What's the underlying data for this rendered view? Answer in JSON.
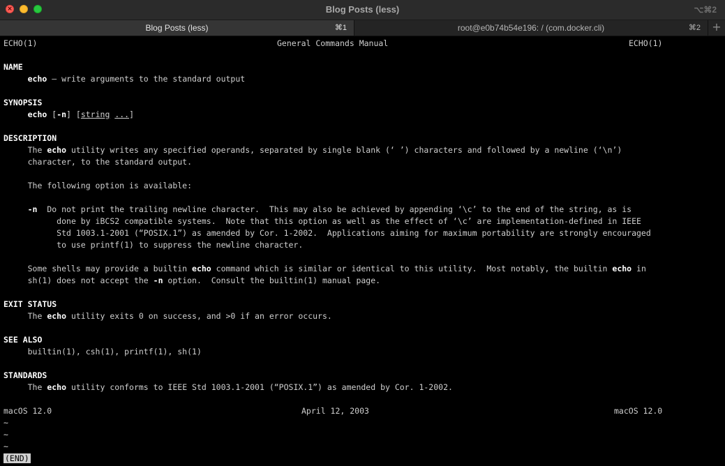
{
  "window": {
    "title": "Blog Posts (less)",
    "shortcut": "⌥⌘2"
  },
  "tabs": [
    {
      "label": "Blog Posts (less)",
      "shortcut": "⌘1",
      "active": true
    },
    {
      "label": "root@e0b74b54e196: / (com.docker.cli)",
      "shortcut": "⌘2",
      "active": false
    }
  ],
  "tab_add": "+",
  "man": {
    "header_left": "ECHO(1)",
    "header_center": "General Commands Manual",
    "header_right": "ECHO(1)",
    "name_heading": "NAME",
    "name_cmd": "echo",
    "name_desc": " – write arguments to the standard output",
    "synopsis_heading": "SYNOPSIS",
    "syn_cmd": "echo",
    "syn_open1": " [",
    "syn_flag": "-n",
    "syn_close1": "] [",
    "syn_string": "string",
    "syn_space": " ",
    "syn_dots": "...",
    "syn_close2": "]",
    "description_heading": "DESCRIPTION",
    "d1_pre": "The ",
    "d1_cmd": "echo",
    "d1_post": " utility writes any specified operands, separated by single blank (‘ ’) characters and followed by a newline (‘\\n’)",
    "d2": "character, to the standard output.",
    "d3": "The following option is available:",
    "opt_flag": "-n",
    "opt1": "  Do not print the trailing newline character.  This may also be achieved by appending ‘\\c’ to the end of the string, as is",
    "opt2": "done by iBCS2 compatible systems.  Note that this option as well as the effect of ‘\\c’ are implementation-defined in IEEE",
    "opt3": "Std 1003.1-2001 (“POSIX.1”) as amended by Cor. 1-2002.  Applications aiming for maximum portability are strongly encouraged",
    "opt4": "to use printf(1) to suppress the newline character.",
    "s1_pre": "Some shells may provide a builtin ",
    "s1_cmd": "echo",
    "s1_mid": " command which is similar or identical to this utility.  Most notably, the builtin ",
    "s1_cmd2": "echo",
    "s1_post": " in",
    "s2_pre": "sh(1) does not accept the ",
    "s2_flag": "-n",
    "s2_post": " option.  Consult the builtin(1) manual page.",
    "exit_heading": "EXIT STATUS",
    "e1_pre": "The ",
    "e1_cmd": "echo",
    "e1_post": " utility exits 0 on success, and >0 if an error occurs.",
    "seealso_heading": "SEE ALSO",
    "seealso": "builtin(1), csh(1), printf(1), sh(1)",
    "standards_heading": "STANDARDS",
    "st_pre": "The ",
    "st_cmd": "echo",
    "st_post": " utility conforms to IEEE Std 1003.1-2001 (“POSIX.1”) as amended by Cor. 1-2002.",
    "footer_left": "macOS 12.0",
    "footer_center": "April 12, 2003",
    "footer_right": "macOS 12.0",
    "tilde": "~",
    "end_marker": "(END)"
  }
}
